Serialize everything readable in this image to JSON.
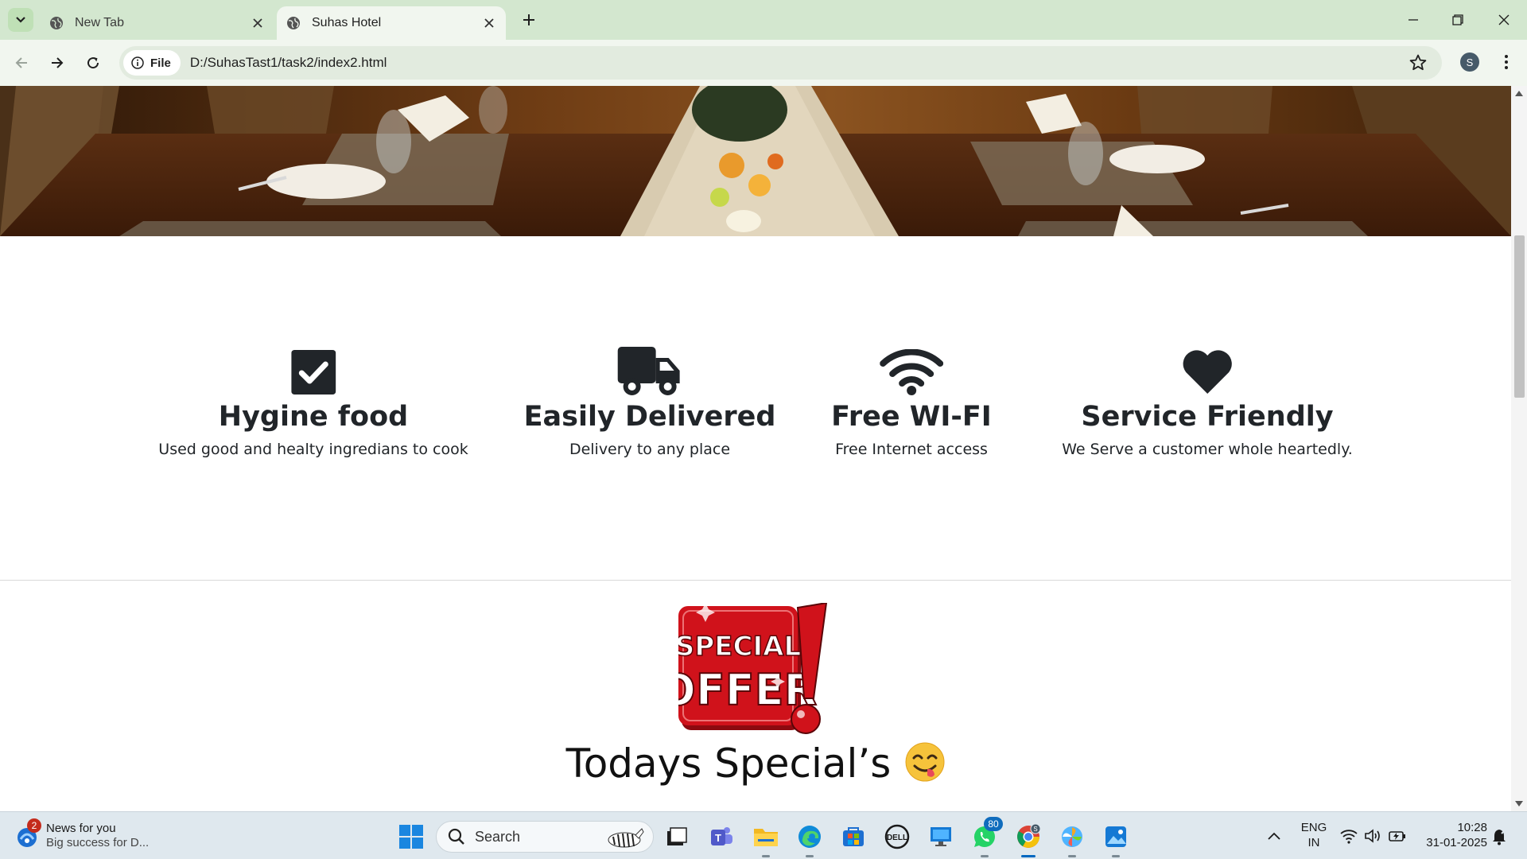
{
  "browser": {
    "tabs": [
      {
        "title": "New Tab",
        "active": false
      },
      {
        "title": "Suhas Hotel",
        "active": true
      }
    ],
    "address": {
      "chip_label": "File",
      "url": "D:/SuhasTast1/task2/index2.html"
    },
    "profile_initial": "S"
  },
  "page": {
    "features": [
      {
        "icon": "check-square-icon",
        "title": "Hygine food",
        "description": "Used good and healty ingredians to cook"
      },
      {
        "icon": "truck-icon",
        "title": "Easily Delivered",
        "description": "Delivery to any place"
      },
      {
        "icon": "wifi-icon",
        "title": "Free WI-FI",
        "description": "Free Internet access"
      },
      {
        "icon": "heart-icon",
        "title": "Service Friendly",
        "description": "We Serve a customer whole heartedly."
      }
    ],
    "offer_badge": {
      "line1": "SPECIAL",
      "line2": "OFFER"
    },
    "specials_heading": "Todays Special’s"
  },
  "taskbar": {
    "news": {
      "badge": "2",
      "title": "News for you",
      "subtitle": "Big success for D..."
    },
    "search_placeholder": "Search",
    "whatsapp_badge": "80",
    "language": {
      "line1": "ENG",
      "line2": "IN"
    },
    "clock": {
      "time": "10:28",
      "date": "31-01-2025"
    }
  },
  "colors": {
    "tabbar": "#d3e7cf",
    "toolbar": "#f1f6ef",
    "text_dark": "#212529",
    "taskbar": "#dfe8ee",
    "offer_red": "#d0121b"
  }
}
